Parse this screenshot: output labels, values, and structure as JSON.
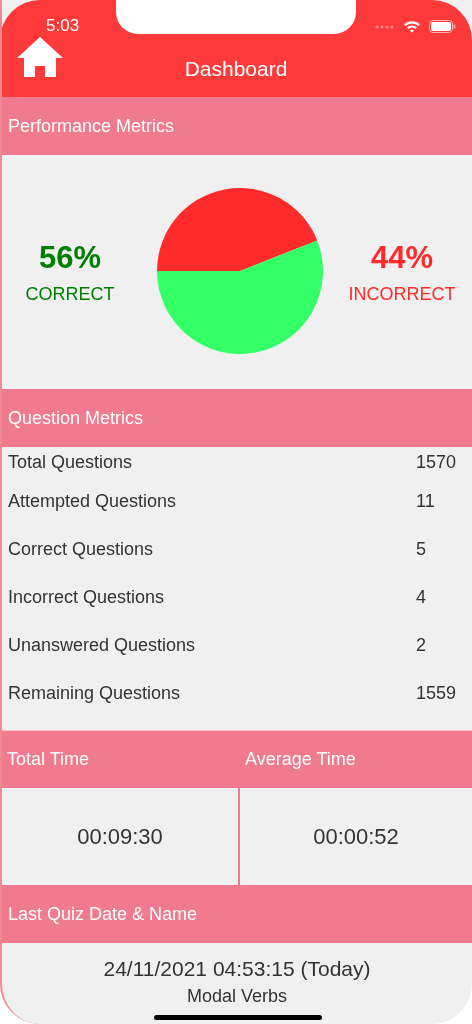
{
  "status_bar": {
    "time": "5:03"
  },
  "nav": {
    "title": "Dashboard"
  },
  "performance": {
    "title": "Performance Metrics",
    "stats": [
      {
        "value": "56%",
        "label": "CORRECT",
        "color": "#008000"
      },
      {
        "value": "44%",
        "label": "INCORRECT",
        "color": "#ff2a2a"
      }
    ],
    "chart_data": {
      "type": "pie",
      "values": [
        56,
        44
      ]
    }
  },
  "question_metrics": {
    "title": "Question Metrics",
    "rows": [
      {
        "label": "Total Questions",
        "value": "1570"
      },
      {
        "label": "Attempted Questions",
        "value": "11"
      },
      {
        "label": "Correct Questions",
        "value": "5"
      },
      {
        "label": "Incorrect Questions",
        "value": "4"
      },
      {
        "label": "Unanswered Questions",
        "value": "2"
      },
      {
        "label": "Remaining Questions",
        "value": "1559"
      }
    ]
  },
  "times": [
    {
      "title": "Total Time",
      "value": "00:09:30"
    },
    {
      "title": "Average Time",
      "value": "00:00:52"
    }
  ],
  "last_quiz": {
    "title": "Last Quiz Date & Name",
    "date": "24/11/2021 04:53:15 (Today)",
    "name": "Modal Verbs"
  }
}
